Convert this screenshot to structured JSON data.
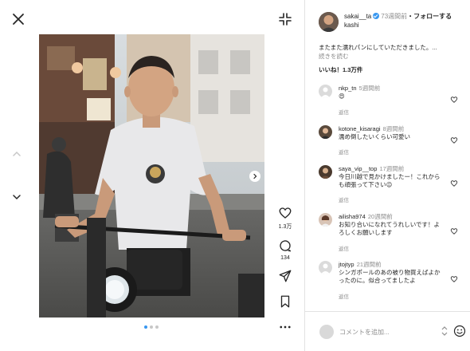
{
  "post": {
    "handle_line1": "sakai__ta",
    "handle_line2": "kashi",
    "time": "73週間前",
    "separator": "・",
    "follow": "フォローする",
    "caption": "またまた濡れパンにしていただきました。",
    "caption_ellipsis": "...",
    "more": "続きを読む",
    "likes": "いいね！1.3万件"
  },
  "actions": {
    "like_count": "1.3万",
    "comment_count": "134"
  },
  "comments": [
    {
      "user": "nkp_tn",
      "time": "5週間前",
      "text": "😍",
      "reply": "返信"
    },
    {
      "user": "kotone_kisaragi",
      "time": "8週間前",
      "text": "濡め倒したいくらい可愛い",
      "reply": "返信"
    },
    {
      "user": "saya_vip__top",
      "time": "17週間前",
      "text": "今日川越で見かけましたー！これからも頑張って下さい😉",
      "reply": "返信"
    },
    {
      "user": "ailisha974",
      "time": "20週間前",
      "text": "お知り合いになれてうれしいです！よろしくお願いします",
      "reply": "返信"
    },
    {
      "user": "jtojtyp",
      "time": "21週間前",
      "text": "シンガポールのあの被り物買えばよかったのに。似合ってましたよ",
      "reply": "返信"
    }
  ],
  "compose": {
    "placeholder": "コメントを追加..."
  },
  "colors": {
    "accent": "#3897f0",
    "muted": "#8e8e8e",
    "text": "#262626"
  },
  "icons": [
    "close-icon",
    "collapse-icon",
    "chevron-up-icon",
    "chevron-down-icon",
    "heart-icon",
    "comment-icon",
    "share-icon",
    "bookmark-icon",
    "more-icon",
    "emoji-icon"
  ]
}
